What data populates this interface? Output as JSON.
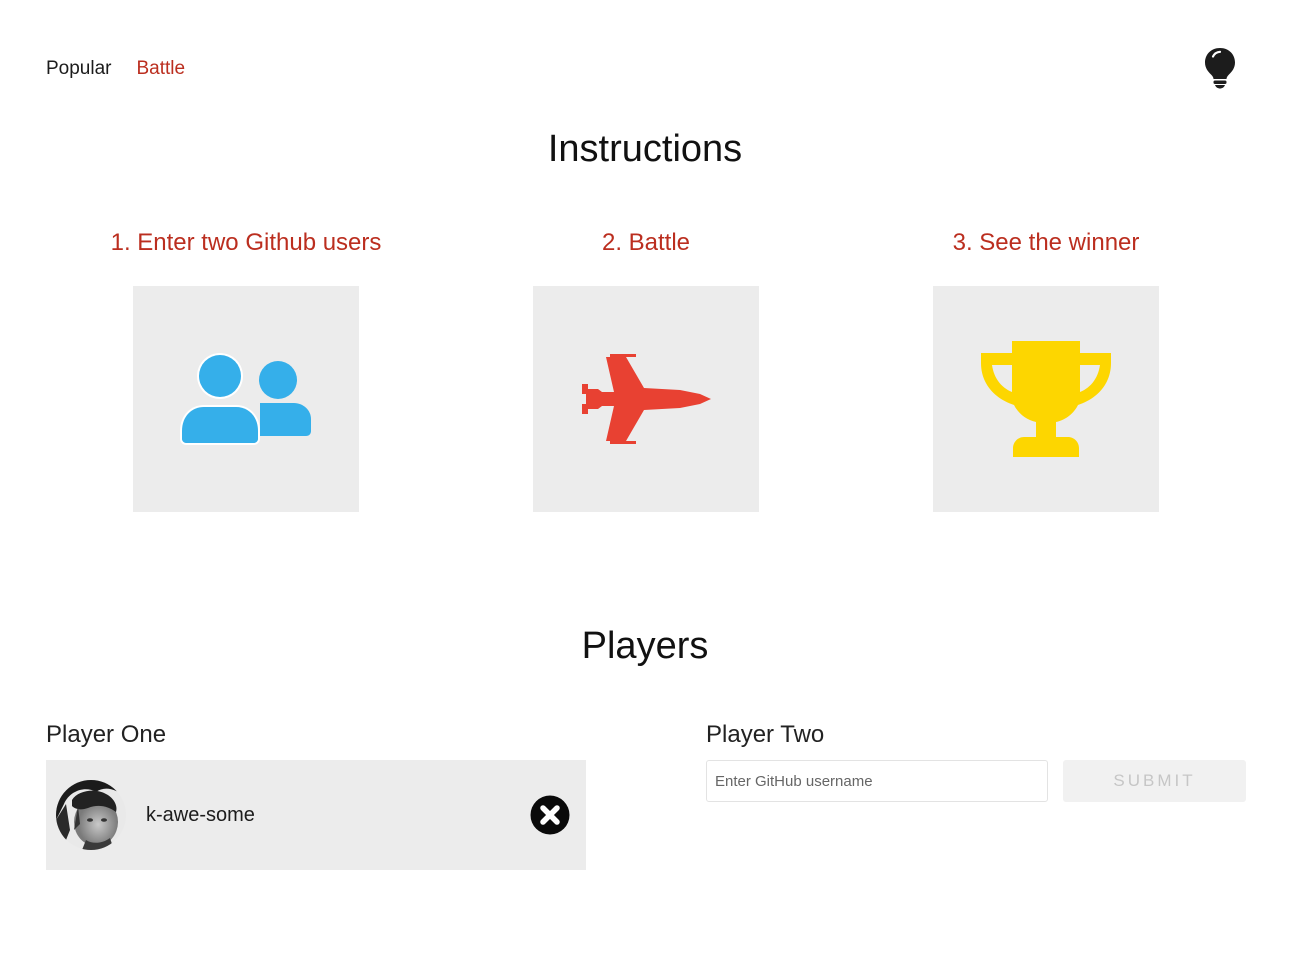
{
  "nav": {
    "popular_label": "Popular",
    "battle_label": "Battle",
    "theme_toggle_icon": "lightbulb-icon"
  },
  "instructions": {
    "title": "Instructions",
    "steps": [
      {
        "label": "1. Enter two Github users",
        "icon": "users-icon",
        "icon_color": "#35afea"
      },
      {
        "label": "2. Battle",
        "icon": "fighter-jet-icon",
        "icon_color": "#e84132"
      },
      {
        "label": "3. See the winner",
        "icon": "trophy-icon",
        "icon_color": "#fdd600"
      }
    ]
  },
  "players": {
    "title": "Players",
    "player_one": {
      "label": "Player One",
      "username": "k-awe-some",
      "avatar_icon": "avatar-photo",
      "reset_icon": "close-circle-icon"
    },
    "player_two": {
      "label": "Player Two",
      "input_value": "",
      "input_placeholder": "Enter GitHub username",
      "submit_label": "SUBMIT"
    }
  },
  "colors": {
    "accent": "#bb2e1f",
    "card_bg": "#ececec",
    "text": "#1c1c1c"
  }
}
